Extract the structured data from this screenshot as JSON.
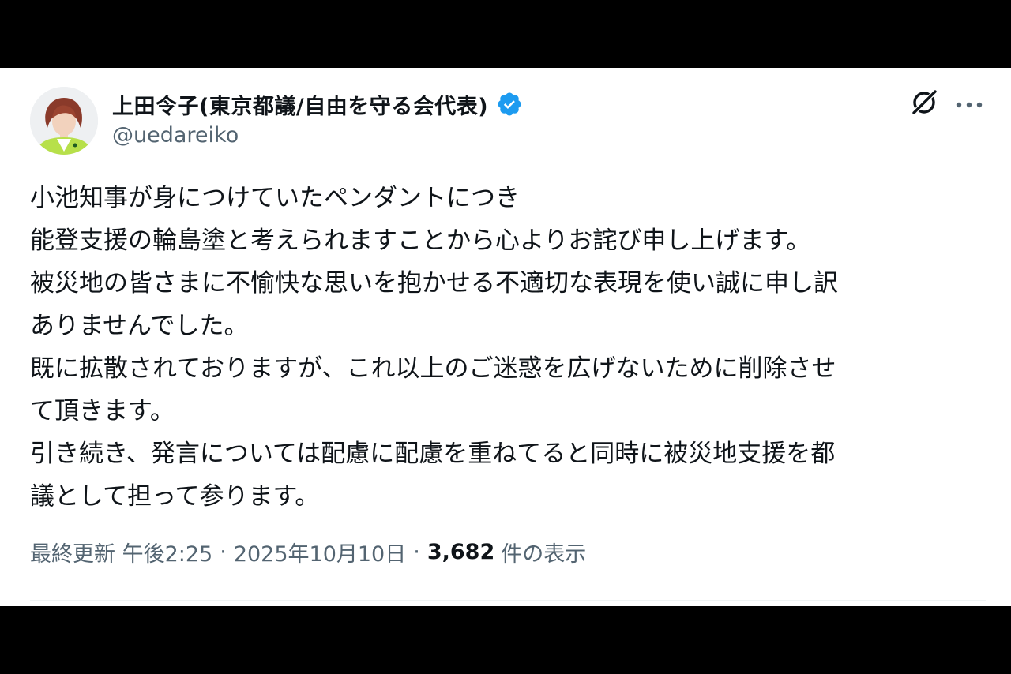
{
  "tweet": {
    "author": {
      "display_name": "上田令子(東京都議/自由を守る会代表)",
      "handle": "@uedareiko"
    },
    "lines": [
      "小池知事が身につけていたペンダントにつき",
      "能登支援の輪島塗と考えられますことから心よりお詫び申し上げます。",
      "被災地の皆さまに不愉快な思いを抱かせる不適切な表現を使い誠に申し訳",
      "ありませんでした。",
      "既に拡散されておりますが、これ以上のご迷惑を広げないために削除させ",
      "て頂きます。",
      "引き続き、発言については配慮に配慮を重ねてると同時に被災地支援を都",
      "議として担って参ります。"
    ],
    "meta": {
      "edited_label": "最終更新 午後2:25",
      "separator": "·",
      "date": "2025年10月10日",
      "views_count": "3,682",
      "views_label": "件の表示"
    }
  },
  "icons": {
    "verified": "verified-badge-icon",
    "grok": "grok-icon",
    "more": "more-icon"
  },
  "colors": {
    "text_primary": "#0f1419",
    "text_secondary": "#536471",
    "verified_blue": "#1d9bf0",
    "frame": "#000000",
    "card": "#ffffff"
  }
}
